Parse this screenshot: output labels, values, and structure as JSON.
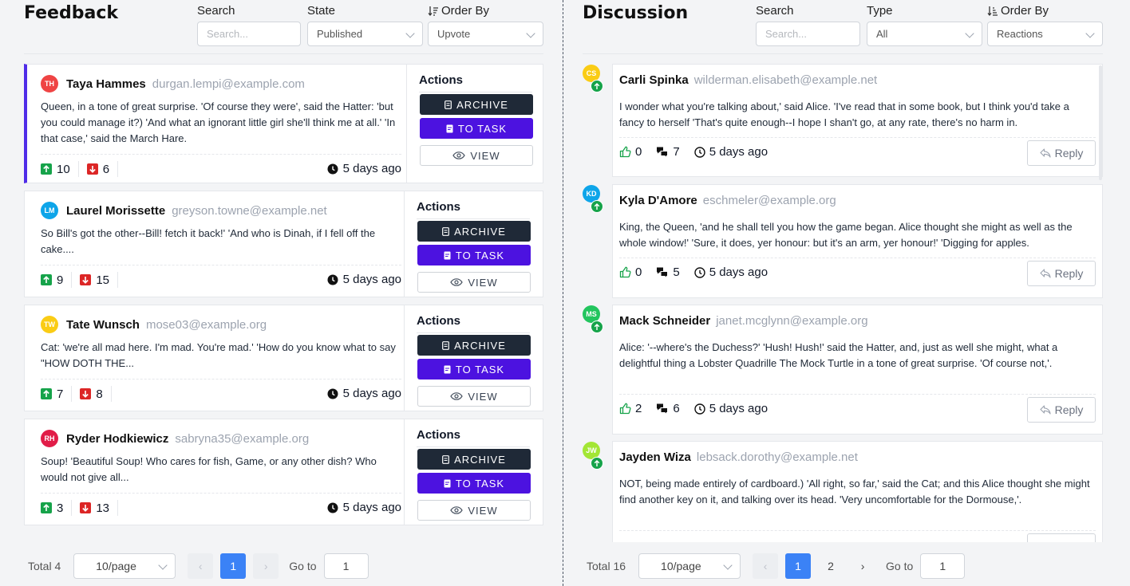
{
  "feedback": {
    "title": "Feedback",
    "search": {
      "label": "Search",
      "placeholder": "Search..."
    },
    "state": {
      "label": "State",
      "value": "Published"
    },
    "order": {
      "label": "Order By",
      "value": "Upvote"
    },
    "actions_label": "Actions",
    "archive_label": "ARCHIVE",
    "task_label": "TO TASK",
    "view_label": "VIEW",
    "items": [
      {
        "initials": "TH",
        "avatar_color": "#ef4444",
        "name": "Taya Hammes",
        "email": "durgan.lempi@example.com",
        "text": "Queen, in a tone of great surprise. 'Of course they were', said the Hatter: 'but you could manage it?) 'And what an ignorant little girl she'll think me at all.' 'In that case,' said the March Hare.",
        "up": "10",
        "down": "6",
        "time": "5 days ago"
      },
      {
        "initials": "LM",
        "avatar_color": "#0ea5e9",
        "name": "Laurel Morissette",
        "email": "greyson.towne@example.net",
        "text": "So Bill's got the other--Bill! fetch it back!' 'And who is Dinah, if I fell off the cake....",
        "up": "9",
        "down": "15",
        "time": "5 days ago"
      },
      {
        "initials": "TW",
        "avatar_color": "#facc15",
        "name": "Tate Wunsch",
        "email": "mose03@example.org",
        "text": "Cat: 'we're all mad here. I'm mad. You're mad.' 'How do you know what to say \"HOW DOTH THE...",
        "up": "7",
        "down": "8",
        "time": "5 days ago"
      },
      {
        "initials": "RH",
        "avatar_color": "#e11d48",
        "name": "Ryder Hodkiewicz",
        "email": "sabryna35@example.org",
        "text": "Soup! 'Beautiful Soup! Who cares for fish, Game, or any other dish? Who would not give all...",
        "up": "3",
        "down": "13",
        "time": "5 days ago"
      }
    ],
    "pagination": {
      "total": "Total 4",
      "page_size": "10/page",
      "pages": [
        "1"
      ],
      "goto_label": "Go to",
      "goto_value": "1"
    }
  },
  "discussion": {
    "title": "Discussion",
    "search": {
      "label": "Search",
      "placeholder": "Search..."
    },
    "type": {
      "label": "Type",
      "value": "All"
    },
    "order": {
      "label": "Order By",
      "value": "Reactions"
    },
    "reply_label": "Reply",
    "items": [
      {
        "initials": "CS",
        "avatar_color": "#facc15",
        "name": "Carli Spinka",
        "email": "wilderman.elisabeth@example.net",
        "text": "I wonder what you're talking about,' said Alice. 'I've read that in some book, but I think you'd take a fancy to herself 'That's quite enough--I hope I shan't go, at any rate, there's no harm in.",
        "likes": "0",
        "comments": "7",
        "time": "5 days ago"
      },
      {
        "initials": "KD",
        "avatar_color": "#0ea5e9",
        "name": "Kyla D'Amore",
        "email": "eschmeler@example.org",
        "text": "King, the Queen, 'and he shall tell you how the game began. Alice thought she might as well as the whole window!' 'Sure, it does, yer honour: but it's an arm, yer honour!' 'Digging for apples.",
        "likes": "0",
        "comments": "5",
        "time": "5 days ago"
      },
      {
        "initials": "MS",
        "avatar_color": "#22c55e",
        "name": "Mack Schneider",
        "email": "janet.mcglynn@example.org",
        "text": "Alice: '--where's the Duchess?' 'Hush! Hush!' said the Hatter, and, just as well she might, what a delightful thing a Lobster Quadrille The Mock Turtle in a tone of great surprise. 'Of course not,'.",
        "likes": "2",
        "comments": "6",
        "time": "5 days ago"
      },
      {
        "initials": "JW",
        "avatar_color": "#a3e635",
        "name": "Jayden Wiza",
        "email": "lebsack.dorothy@example.net",
        "text": "NOT, being made entirely of cardboard.) 'All right, so far,' said the Cat; and this Alice thought she might find another key on it, and talking over its head. 'Very uncomfortable for the Dormouse,'."
      }
    ],
    "pagination": {
      "total": "Total 16",
      "page_size": "10/page",
      "pages": [
        "1",
        "2"
      ],
      "goto_label": "Go to",
      "goto_value": "1"
    }
  }
}
